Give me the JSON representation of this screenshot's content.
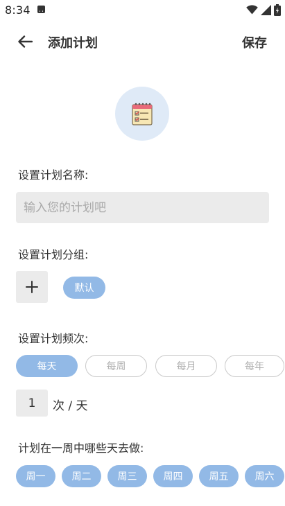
{
  "status_bar": {
    "time": "8:34"
  },
  "header": {
    "title": "添加计划",
    "save_label": "保存"
  },
  "plan_name": {
    "label": "设置计划名称:",
    "placeholder": "输入您的计划吧",
    "value": ""
  },
  "group": {
    "label": "设置计划分组:",
    "groups": [
      {
        "label": "默认",
        "selected": true
      }
    ]
  },
  "frequency": {
    "label": "设置计划频次:",
    "options": [
      {
        "label": "每天",
        "selected": true
      },
      {
        "label": "每周",
        "selected": false
      },
      {
        "label": "每月",
        "selected": false
      },
      {
        "label": "每年",
        "selected": false
      }
    ],
    "count": "1",
    "unit": "次 / 天"
  },
  "weekdays": {
    "label": "计划在一周中哪些天去做:",
    "days": [
      {
        "label": "周一",
        "selected": true
      },
      {
        "label": "周二",
        "selected": true
      },
      {
        "label": "周三",
        "selected": true
      },
      {
        "label": "周四",
        "selected": true
      },
      {
        "label": "周五",
        "selected": true
      },
      {
        "label": "周六",
        "selected": true
      }
    ]
  },
  "colors": {
    "accent": "#92b9e6",
    "icon_bg": "#dfeaf7",
    "input_bg": "#ebebeb",
    "chip_outline": "#c9c9c9"
  },
  "icons": {
    "back": "arrow-left-icon",
    "plan": "notepad-checklist-icon",
    "add": "plus-icon"
  }
}
